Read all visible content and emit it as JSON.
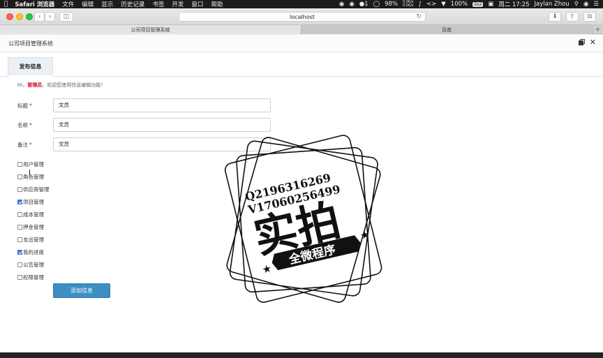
{
  "menubar": {
    "apple_icon": "apple-logo-icon",
    "items": [
      "Safari 浏览器",
      "文件",
      "编辑",
      "显示",
      "历史记录",
      "书签",
      "开发",
      "窗口",
      "帮助"
    ],
    "status": {
      "qq_count": "1",
      "battery": "98%",
      "net_up": "0.0K/s",
      "net_down": "0.0K/s",
      "wifi_level": "100%",
      "badge": "2x2",
      "clock": "周二 17:25",
      "user": "Jaylan Zhou"
    }
  },
  "browser": {
    "url": "localhost",
    "tabs": [
      {
        "label": "公司项目管理系统",
        "active": true
      },
      {
        "label": "百度",
        "active": false
      }
    ],
    "new_tab_symbol": "+"
  },
  "panel": {
    "title": "公司项目管理系统",
    "publish_tab": "发布信息"
  },
  "greeting": {
    "prefix": "Hi，",
    "role": "管理员",
    "suffix": "，欢迎您使用信息编辑功能！"
  },
  "form": {
    "title_label": "标题",
    "title_value": "文员",
    "name_label": "名称",
    "name_value": "文员",
    "note_label": "备注",
    "note_value": "文员",
    "required_mark": "*"
  },
  "permissions": [
    {
      "label": "用户管理",
      "checked": false
    },
    {
      "label": "角色管理",
      "checked": false
    },
    {
      "label": "供应商管理",
      "checked": false
    },
    {
      "label": "项目管理",
      "checked": true
    },
    {
      "label": "成本管理",
      "checked": false
    },
    {
      "label": "押金管理",
      "checked": false
    },
    {
      "label": "支出管理",
      "checked": false
    },
    {
      "label": "我的进度",
      "checked": true
    },
    {
      "label": "公告管理",
      "checked": false
    },
    {
      "label": "权限管理",
      "checked": false
    }
  ],
  "submit_label": "添加信息",
  "watermark": {
    "line1": "Q2196316269",
    "line2": "V17060256499",
    "big": "实拍",
    "ribbon": "全微程序"
  }
}
